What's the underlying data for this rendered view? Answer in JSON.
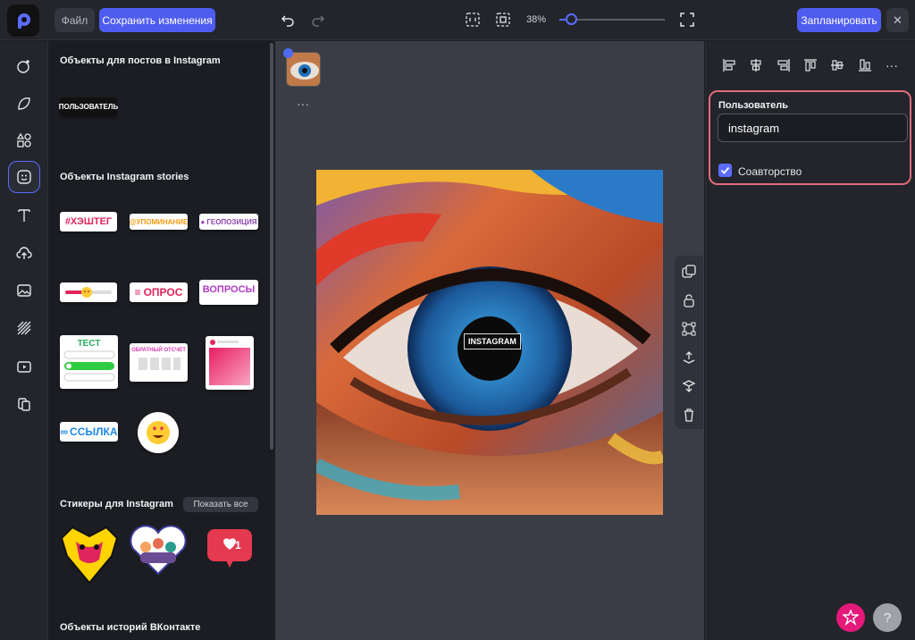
{
  "topbar": {
    "file_label": "Файл",
    "save_label": "Сохранить изменения",
    "zoom": "38%",
    "zoom_level": 0.11,
    "schedule_label": "Запланировать",
    "close_label": "✕"
  },
  "rail_icons": [
    "emoji-add-icon",
    "sticker-icon",
    "shapes-icon",
    "smiley-sticker-icon",
    "text-icon",
    "upload-cloud-icon",
    "image-icon",
    "pattern-icon",
    "video-icon",
    "pages-icon"
  ],
  "panel": {
    "sec1_title": "Объекты для постов в Instagram",
    "user_chip": "ПОЛЬЗОВАТЕЛЬ",
    "sec2_title": "Объекты Instagram stories",
    "hashtag": "#ХЭШТЕГ",
    "mention": "@УПОМИНАНИЕ",
    "geo": "ГЕОПОЗИЦИЯ",
    "poll": "ОПРОС",
    "questions": "ВОПРОСЫ",
    "quiz": "ТЕСТ",
    "countdown": "ОБРАТНЫЙ ОТСЧЕТ",
    "link": "ССЫЛКА",
    "sec3_title": "Стикеры для Instagram",
    "show_all": "Показать все",
    "badge_count": "1",
    "sec4_title": "Объекты историй ВКонтакте"
  },
  "canvas": {
    "thumb_more": "···",
    "instagram_label": "INSTAGRAM"
  },
  "right": {
    "user_label": "Пользователь",
    "user_value": "instagram",
    "coauthor_label": "Соавторство",
    "more": "···"
  },
  "colors": {
    "accent": "#4f5cf0",
    "highlight_border": "#e06b7b",
    "pink_fab": "#e5197a"
  }
}
